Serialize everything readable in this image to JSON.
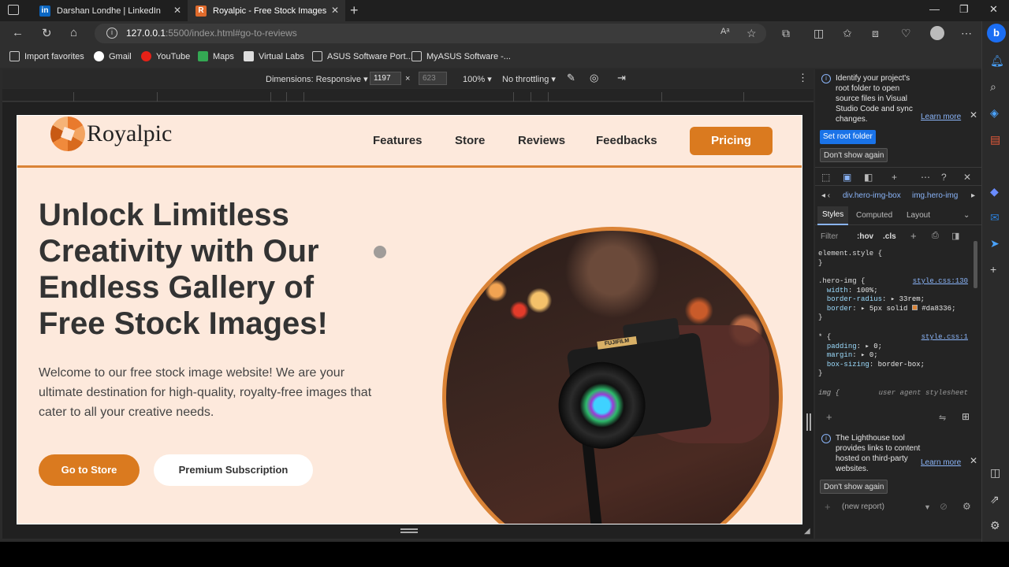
{
  "tabs": [
    {
      "title": "Darshan Londhe | LinkedIn",
      "favicon_color": "#0a66c2",
      "favicon": "in"
    },
    {
      "title": "Royalpic - Free Stock Images",
      "favicon_color": "#e06b2c",
      "favicon": "R"
    }
  ],
  "address": {
    "host": "127.0.0.1",
    "path": ":5500/index.html#go-to-reviews"
  },
  "bookmarks": [
    "Import favorites",
    "Gmail",
    "YouTube",
    "Maps",
    "Virtual Labs",
    "ASUS Software Port...",
    "MyASUS Software -..."
  ],
  "device_toolbar": {
    "dimensions": "Dimensions: Responsive",
    "width": "1197",
    "times": "×",
    "height": "623",
    "zoom": "100%",
    "throttle": "No throttling"
  },
  "site": {
    "logo": "Royalpic",
    "nav": [
      "Features",
      "Store",
      "Reviews",
      "Feedbacks"
    ],
    "pricing": "Pricing",
    "hero_title": "Unlock Limitless Creativity with Our Endless Gallery of Free Stock Images!",
    "hero_desc": "Welcome to our free stock image website! We are your ultimate destination for high-quality, royalty-free images that cater to all your creative needs.",
    "btn_store": "Go to Store",
    "btn_premium": "Premium Subscription",
    "camera_brand": "FUJIFILM",
    "accent": "#da8336"
  },
  "devtools": {
    "notice1": "Identify your project's root folder to open source files in Visual Studio Code and sync changes.",
    "learn_more": "Learn more",
    "set_root": "Set root folder",
    "dont_show": "Don't show again",
    "crumb1": "div.hero-img-box",
    "crumb2": "img.hero-img",
    "tab_styles": "Styles",
    "tab_computed": "Computed",
    "tab_layout": "Layout",
    "filter": "Filter",
    "hov": ":hov",
    "cls": ".cls",
    "css_element": "element.style {",
    "css_close": "}",
    "hero_selector": ".hero-img {",
    "hero_link": "style.css:130",
    "width_prop": "width",
    "width_val": "100%;",
    "radius_prop": "border-radius",
    "radius_val": "33rem;",
    "border_prop": "border",
    "border_val": "5px solid",
    "border_color": "#da8336;",
    "star_selector": "* {",
    "star_link": "style.css:1",
    "padding_prop": "padding",
    "padding_val": "0;",
    "margin_prop": "margin",
    "margin_val": "0;",
    "boxsizing_prop": "box-sizing",
    "boxsizing_val": "border-box;",
    "img_selector": "img {",
    "ua_label": "user agent stylesheet",
    "notice2": "The Lighthouse tool provides links to content hosted on third-party websites.",
    "new_report": "(new report)"
  }
}
